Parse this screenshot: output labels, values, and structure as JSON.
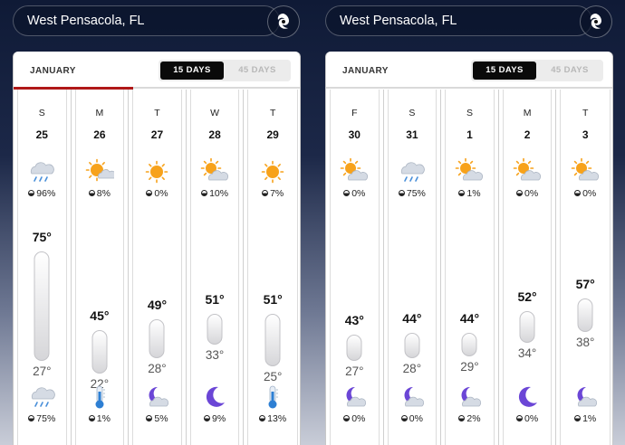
{
  "panels": [
    {
      "location": "West Pensacola, FL",
      "month": "JANUARY",
      "tabs": {
        "active": "15 DAYS",
        "inactive": "45 DAYS"
      },
      "days": [
        {
          "dow": "S",
          "date": "25",
          "icon": "rain-cloud-icon",
          "precip": "96%",
          "high": "75°",
          "low": "27°",
          "night_icon": "rain-cloud-icon",
          "night_precip": "75%",
          "hi_temp": 75,
          "lo_temp": 27
        },
        {
          "dow": "M",
          "date": "26",
          "icon": "partly-sunny-icon",
          "precip": "8%",
          "high": "45°",
          "low": "22°",
          "night_icon": "cold-thermometer-icon",
          "night_precip": "1%",
          "hi_temp": 45,
          "lo_temp": 22
        },
        {
          "dow": "T",
          "date": "27",
          "icon": "sunny-icon",
          "precip": "0%",
          "high": "49°",
          "low": "28°",
          "night_icon": "moon-cloud-icon",
          "night_precip": "5%",
          "hi_temp": 49,
          "lo_temp": 28
        },
        {
          "dow": "W",
          "date": "28",
          "icon": "sun-cloud-icon",
          "precip": "10%",
          "high": "51°",
          "low": "33°",
          "night_icon": "moon-icon",
          "night_precip": "9%",
          "hi_temp": 51,
          "lo_temp": 33
        },
        {
          "dow": "T",
          "date": "29",
          "icon": "sunny-icon",
          "precip": "7%",
          "high": "51°",
          "low": "25°",
          "night_icon": "cold-thermometer-icon",
          "night_precip": "13%",
          "hi_temp": 51,
          "lo_temp": 25
        }
      ]
    },
    {
      "location": "West Pensacola, FL",
      "month": "JANUARY",
      "tabs": {
        "active": "15 DAYS",
        "inactive": "45 DAYS"
      },
      "days": [
        {
          "dow": "F",
          "date": "30",
          "icon": "sun-cloud-icon",
          "precip": "0%",
          "high": "43°",
          "low": "27°",
          "night_icon": "moon-cloud-icon",
          "night_precip": "0%",
          "hi_temp": 43,
          "lo_temp": 27
        },
        {
          "dow": "S",
          "date": "31",
          "icon": "rain-cloud-icon",
          "precip": "75%",
          "high": "44°",
          "low": "28°",
          "night_icon": "moon-cloud-icon",
          "night_precip": "0%",
          "hi_temp": 44,
          "lo_temp": 28
        },
        {
          "dow": "S",
          "date": "1",
          "icon": "sun-cloud-icon",
          "precip": "1%",
          "high": "44°",
          "low": "29°",
          "night_icon": "moon-cloud-icon",
          "night_precip": "2%",
          "hi_temp": 44,
          "lo_temp": 29
        },
        {
          "dow": "M",
          "date": "2",
          "icon": "sun-cloud-icon",
          "precip": "0%",
          "high": "52°",
          "low": "34°",
          "night_icon": "moon-icon",
          "night_precip": "0%",
          "hi_temp": 52,
          "lo_temp": 34
        },
        {
          "dow": "T",
          "date": "3",
          "icon": "sun-cloud-icon",
          "precip": "0%",
          "high": "57°",
          "low": "38°",
          "night_icon": "moon-cloud-icon",
          "night_precip": "1%",
          "hi_temp": 57,
          "lo_temp": 38
        }
      ]
    }
  ],
  "colors": {
    "accent": "#b01818",
    "sun": "#f7a21b",
    "moon": "#6b46d6",
    "cloud": "#cfd6e0"
  }
}
